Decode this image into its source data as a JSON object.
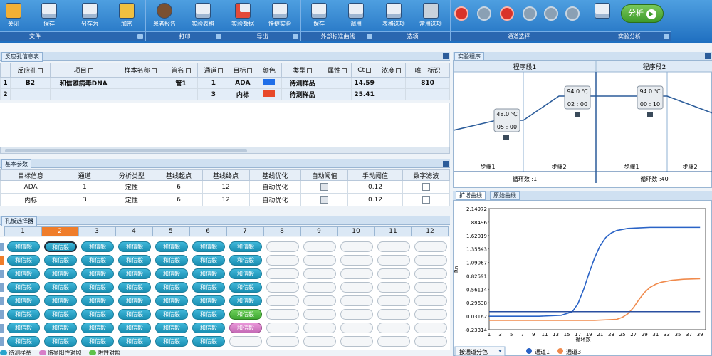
{
  "toolbar": {
    "buttons": [
      {
        "label": "关闭",
        "icon": "folder-icon"
      },
      {
        "label": "保存",
        "icon": "save-icon"
      },
      {
        "label": "另存为",
        "icon": "save-as-icon"
      },
      {
        "label": "加密",
        "icon": "lock-icon"
      },
      {
        "label": "患者报告",
        "icon": "patient-report-icon"
      },
      {
        "label": "实验表格",
        "icon": "table-icon"
      },
      {
        "label": "实验数据",
        "icon": "data-icon"
      },
      {
        "label": "快捷实验",
        "icon": "quick-experiment-icon"
      },
      {
        "label": "保存",
        "icon": "curve-save-icon"
      },
      {
        "label": "调用",
        "icon": "curve-load-icon"
      },
      {
        "label": "表格选项",
        "icon": "table-options-icon"
      },
      {
        "label": "常用选项",
        "icon": "wrench-icon"
      }
    ],
    "groups": [
      "文件",
      "打印",
      "导出",
      "外部标准曲线",
      "选项",
      "通道选择",
      "实验分析"
    ],
    "analyze_label": "分析",
    "channel_states": [
      true,
      false,
      true,
      false,
      false,
      false
    ]
  },
  "reaction_info": {
    "title": "反应孔信息表",
    "columns": [
      "反应孔",
      "项目",
      "样本名称",
      "管名",
      "通道",
      "目标",
      "颜色",
      "类型",
      "属性",
      "Ct",
      "浓度",
      "唯一标识"
    ],
    "rows": [
      {
        "num": "1",
        "well": "B2",
        "project": "和信雅病毒DNA",
        "sample": "",
        "tube": "管1",
        "channel": "1",
        "target": "ADA",
        "color": "#1f6ee8",
        "type": "待测样品",
        "attr": "",
        "ct": "14.59",
        "conc": "",
        "uid": "810"
      },
      {
        "num": "2",
        "well": "",
        "project": "",
        "sample": "",
        "tube": "",
        "channel": "3",
        "target": "内标",
        "color": "#e8492a",
        "type": "待测样品",
        "attr": "",
        "ct": "25.41",
        "conc": "",
        "uid": ""
      }
    ]
  },
  "basic_params": {
    "title": "基本参数",
    "columns": [
      "目标信息",
      "通道",
      "分析类型",
      "基线起点",
      "基线终点",
      "基线优化",
      "自动阈值",
      "手动阈值",
      "数字滤波"
    ],
    "rows": [
      {
        "target": "ADA",
        "channel": "1",
        "type": "定性",
        "start": "6",
        "end": "12",
        "opt": "自动优化",
        "threshold": "0.12"
      },
      {
        "target": "内标",
        "channel": "3",
        "type": "定性",
        "start": "6",
        "end": "12",
        "opt": "自动优化",
        "threshold": "0.12"
      }
    ]
  },
  "plate": {
    "title": "孔板选择器",
    "columns": [
      "1",
      "2",
      "3",
      "4",
      "5",
      "6",
      "7",
      "8",
      "9",
      "10",
      "11",
      "12"
    ],
    "well_label": "和信毅",
    "rows": [
      [
        "b",
        "s",
        "b",
        "b",
        "b",
        "b",
        "b",
        "e",
        "e",
        "e",
        "e",
        "e"
      ],
      [
        "b",
        "b",
        "b",
        "b",
        "b",
        "b",
        "b",
        "e",
        "e",
        "e",
        "e",
        "e"
      ],
      [
        "b",
        "b",
        "b",
        "b",
        "b",
        "b",
        "b",
        "e",
        "e",
        "e",
        "e",
        "e"
      ],
      [
        "b",
        "b",
        "b",
        "b",
        "b",
        "b",
        "b",
        "e",
        "e",
        "e",
        "e",
        "e"
      ],
      [
        "b",
        "b",
        "b",
        "b",
        "b",
        "b",
        "b",
        "e",
        "e",
        "e",
        "e",
        "e"
      ],
      [
        "b",
        "b",
        "b",
        "b",
        "b",
        "b",
        "g",
        "e",
        "e",
        "e",
        "e",
        "e"
      ],
      [
        "b",
        "b",
        "b",
        "b",
        "b",
        "b",
        "p",
        "e",
        "e",
        "e",
        "e",
        "e"
      ],
      [
        "b",
        "b",
        "b",
        "b",
        "b",
        "b",
        "e",
        "e",
        "e",
        "e",
        "e",
        "e"
      ]
    ],
    "legend": [
      "待测样品",
      "临界阳性对照",
      "阴性对照"
    ]
  },
  "experiment": {
    "title": "实验程序",
    "stage1": "程序段1",
    "stage2": "程序段2",
    "holds": [
      {
        "temp": "48.0 ℃",
        "time": "05 : 00"
      },
      {
        "temp": "94.0 ℃",
        "time": "02 : 00"
      },
      {
        "temp": "94.0 ℃",
        "time": "00 : 10"
      }
    ],
    "steps": [
      "步骤1",
      "步骤2",
      "步骤1",
      "步骤2"
    ],
    "cycles1": "循环数 :1",
    "cycles2": "循环数 :40"
  },
  "amplification": {
    "tab1": "扩增曲线",
    "tab2": "原始曲线",
    "ylabel": "Rn",
    "xlabel": "循环数",
    "selector": "按通道分色",
    "legend": [
      "通道1",
      "通道3"
    ],
    "colors": [
      "#2a63c6",
      "#f08a4c"
    ]
  },
  "chart_data": {
    "type": "line",
    "title": "",
    "xlabel": "循环数",
    "ylabel": "Rn",
    "x_ticks": [
      1,
      3,
      5,
      7,
      9,
      11,
      13,
      15,
      17,
      19,
      21,
      23,
      25,
      27,
      29,
      31,
      33,
      35,
      37,
      39
    ],
    "y_ticks": [
      2.14972,
      1.88496,
      1.62019,
      1.35543,
      1.09067,
      0.82591,
      0.56114,
      0.29638,
      0.03162,
      -0.23314
    ],
    "ylim": [
      -0.23314,
      2.14972
    ],
    "xlim": [
      1,
      40
    ],
    "series": [
      {
        "name": "通道1",
        "values_x": [
          1,
          10,
          14,
          16,
          17,
          18,
          19,
          20,
          21,
          22,
          23,
          24,
          26,
          28,
          30,
          35,
          39
        ],
        "values_y": [
          0.03,
          0.03,
          0.05,
          0.12,
          0.28,
          0.55,
          0.88,
          1.18,
          1.42,
          1.58,
          1.67,
          1.72,
          1.76,
          1.77,
          1.78,
          1.78,
          1.78
        ]
      },
      {
        "name": "通道3",
        "values_x": [
          1,
          20,
          24,
          25,
          26,
          27,
          28,
          29,
          30,
          31,
          32,
          34,
          36,
          39
        ],
        "values_y": [
          -0.05,
          -0.05,
          -0.03,
          0.01,
          0.08,
          0.2,
          0.36,
          0.5,
          0.6,
          0.66,
          0.7,
          0.74,
          0.76,
          0.77
        ]
      },
      {
        "name": "",
        "values_x": [
          1,
          39
        ],
        "values_y": [
          0.12,
          0.12
        ]
      }
    ]
  }
}
